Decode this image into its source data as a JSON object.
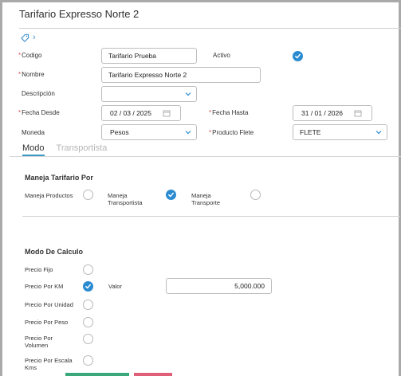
{
  "window": {
    "title": "Tarifario Expresso Norte 2"
  },
  "breadcrumb": {
    "tag_icon": "tag-icon",
    "chevron": "›"
  },
  "form": {
    "codigo_label": "Codigo",
    "codigo_value": "Tarifario Prueba",
    "activo_label": "Activo",
    "nombre_label": "Nombre",
    "nombre_value": "Tarifario Expresso Norte 2",
    "descripcion_label": "Descripción",
    "descripcion_value": "",
    "fecha_desde_label": "Fecha Desde",
    "fecha_desde_value": "02 / 03 / 2025",
    "fecha_hasta_label": "Fecha Hasta",
    "fecha_hasta_value": "31 / 01 / 2026",
    "moneda_label": "Moneda",
    "moneda_value": "Pesos",
    "producto_flete_label": "Producto Flete",
    "producto_flete_value": "FLETE",
    "required_mark": "*"
  },
  "tabs": [
    {
      "label": "Modo",
      "active": true
    },
    {
      "label": "Transportista",
      "active": false
    }
  ],
  "maneja": {
    "title": "Maneja Tarifario Por",
    "options": [
      {
        "label": "Maneja Productos",
        "checked": false
      },
      {
        "label": "Maneja Transportista",
        "checked": true
      },
      {
        "label": "Maneja Transporte",
        "checked": false
      }
    ]
  },
  "modo_calculo": {
    "title": "Modo De Calculo",
    "options": [
      {
        "label": "Precio Fijo",
        "checked": false
      },
      {
        "label": "Precio Por KM",
        "checked": true
      },
      {
        "label": "Precio Por Unidad",
        "checked": false
      },
      {
        "label": "Precio Por Peso",
        "checked": false
      },
      {
        "label": "Precio Por Volumen",
        "checked": false
      },
      {
        "label": "Precio Por Escala Kms",
        "checked": false
      }
    ],
    "valor_label": "Valor",
    "valor_value": "5,000.000"
  },
  "colors": {
    "accent": "#2a8bd1",
    "required": "#d9534f",
    "tab_underline": "#3a9ac6",
    "bottom_green": "#3aa87a",
    "bottom_pink": "#e0607a"
  }
}
